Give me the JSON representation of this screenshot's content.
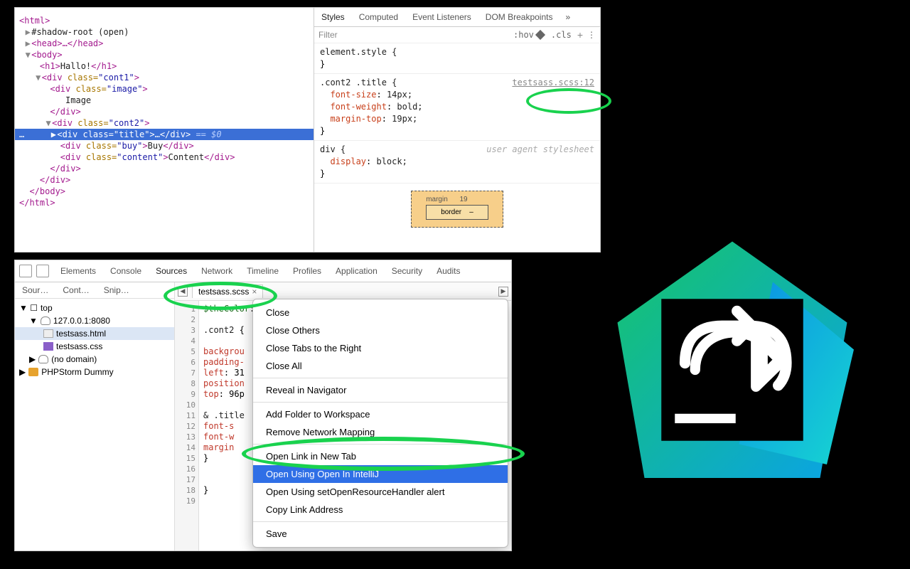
{
  "elements_panel": {
    "dom": {
      "html_open": "<html>",
      "shadow": "#shadow-root (open)",
      "head": "<head>…</head>",
      "body_open": "<body>",
      "h1": "<h1>Hallo!</h1>",
      "cont1_open": "<div class=\"cont1\">",
      "image_open": "<div class=\"image\">",
      "image_text": "Image",
      "image_close": "</div>",
      "cont2_open": "<div class=\"cont2\">",
      "title_sel": "<div class=\"title\">…</div>",
      "eq0": " == $0",
      "buy": "<div class=\"buy\">Buy</div>",
      "content": "<div class=\"content\">Content</div>",
      "div_close1": "</div>",
      "div_close2": "</div>",
      "body_close": "</body>",
      "html_close": "</html>"
    },
    "tabs": [
      "Styles",
      "Computed",
      "Event Listeners",
      "DOM Breakpoints"
    ],
    "more": "»",
    "filter_placeholder": "Filter",
    "hov": ":hov",
    "cls": ".cls",
    "plus": "+",
    "rule0": "element.style {",
    "rule0_close": "}",
    "rule1_sel": ".cont2 .title {",
    "rule1_link": "testsass.scss:12",
    "rule1_props": [
      {
        "p": "font-size",
        "v": "14px;"
      },
      {
        "p": "font-weight",
        "v": "bold;"
      },
      {
        "p": "margin-top",
        "v": "19px;"
      }
    ],
    "rule1_close": "}",
    "rule2_sel": "div {",
    "rule2_uas": "user agent stylesheet",
    "rule2_props": [
      {
        "p": "display",
        "v": "block;"
      }
    ],
    "rule2_close": "}",
    "boxmodel": {
      "margin_label": "margin",
      "margin_top": "19",
      "border_label": "border",
      "border_val": "–"
    }
  },
  "sources_panel": {
    "dt_tabs": [
      "Elements",
      "Console",
      "Sources",
      "Network",
      "Timeline",
      "Profiles",
      "Application",
      "Security",
      "Audits"
    ],
    "side_tabs": [
      "Sour…",
      "Cont…",
      "Snip…"
    ],
    "tree": {
      "top": "top",
      "host": "127.0.0.1:8080",
      "f1": "testsass.html",
      "f2": "testsass.css",
      "nodomain": "(no domain)",
      "phps": "PHPStorm Dummy"
    },
    "open_file": "testsass.scss",
    "gutter": [
      "1",
      "2",
      "3",
      "4",
      "5",
      "6",
      "7",
      "8",
      "9",
      "10",
      "11",
      "12",
      "13",
      "14",
      "15",
      "16",
      "17",
      "18",
      "19"
    ],
    "code_lines": [
      "$theColor:",
      "",
      ".cont2 {",
      "",
      "  backgrou",
      "  padding-",
      "  left: 31",
      "  position",
      "  top: 96p",
      "",
      "  & .title",
      "    font-s",
      "    font-w",
      "    margin",
      "  }",
      "",
      "",
      "}"
    ]
  },
  "context_menu": {
    "items_a": [
      "Close",
      "Close Others",
      "Close Tabs to the Right",
      "Close All"
    ],
    "items_b": [
      "Reveal in Navigator"
    ],
    "items_c": [
      "Add Folder to Workspace",
      "Remove Network Mapping"
    ],
    "items_d": [
      "Open Link in New Tab",
      "Open Using Open In IntelliJ",
      "Open Using setOpenResourceHandler alert",
      "Copy Link Address"
    ],
    "items_e": [
      "Save"
    ],
    "highlight": "Open Using Open In IntelliJ"
  }
}
